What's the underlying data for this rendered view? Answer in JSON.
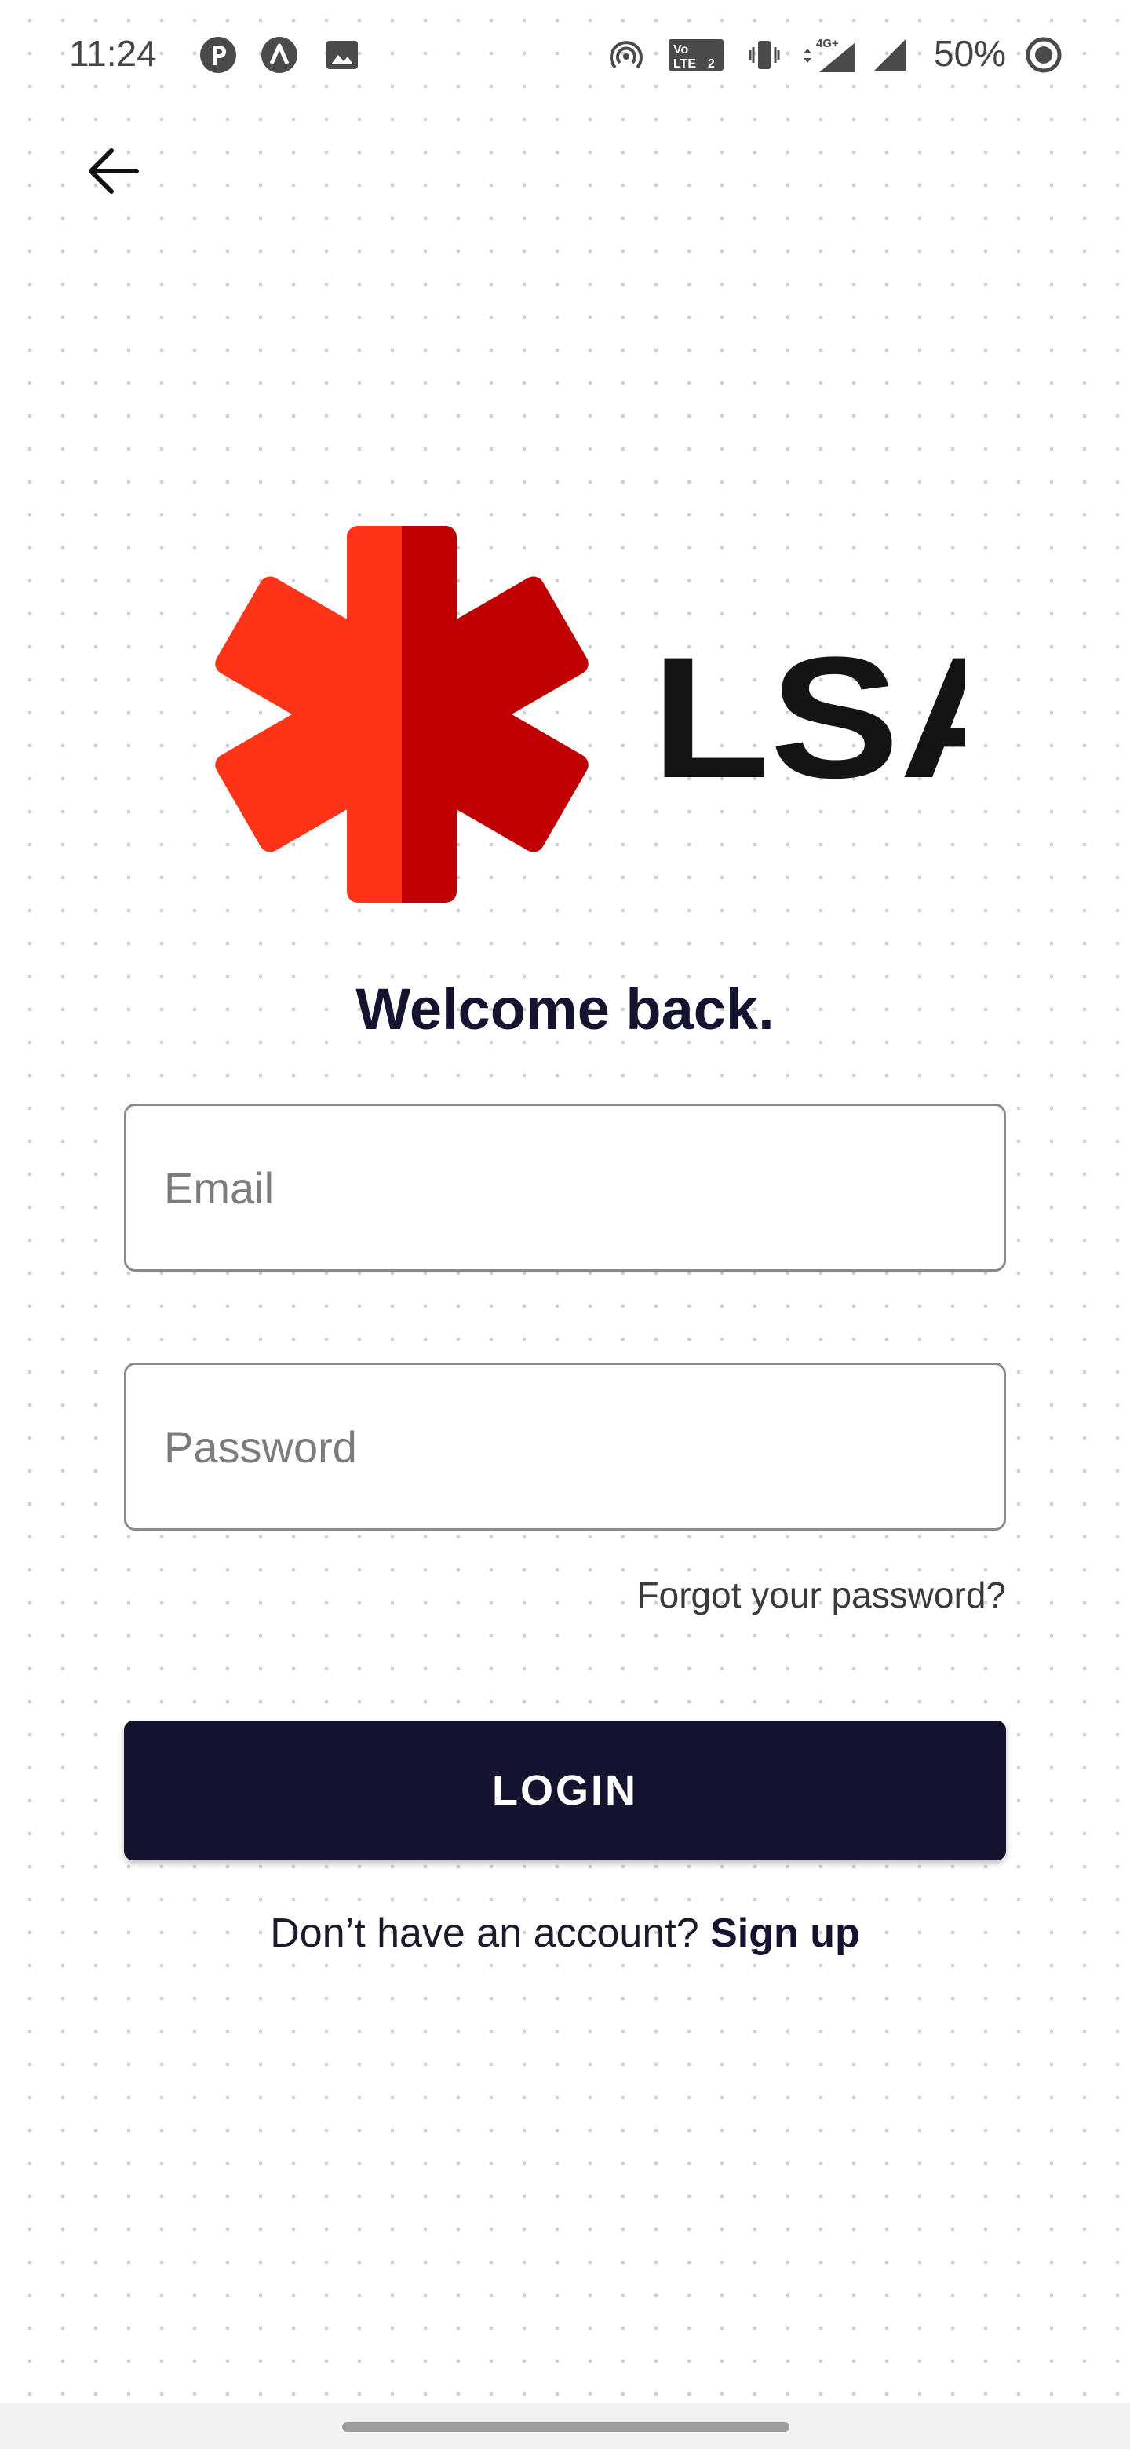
{
  "status_bar": {
    "time": "11:24",
    "battery_percent_text": "50%",
    "network_label": "4G+",
    "volte_label": "VoLTE",
    "sim_label": "2",
    "icons": [
      "p-app-icon",
      "a-app-icon",
      "image-icon",
      "hotspot-icon",
      "volte-icon",
      "vibrate-icon",
      "signal-4g-icon",
      "signal-icon",
      "battery-saver-icon"
    ]
  },
  "header": {
    "back_icon": "arrow-left-icon"
  },
  "logo": {
    "text": "LSAS",
    "colors": {
      "star_left": "#fd3418",
      "star_right": "#c00000",
      "text": "#141414"
    }
  },
  "form": {
    "title": "Welcome back.",
    "email_placeholder": "Email",
    "email_value": "",
    "password_placeholder": "Password",
    "password_value": "",
    "forgot_password_label": "Forgot your password?",
    "login_label": "LOGIN",
    "signup_prompt": "Don’t have an account?",
    "signup_label": "Sign up"
  },
  "colors": {
    "primary": "#141431",
    "background": "#ffffff",
    "dot_pattern": "#cfcfcf"
  }
}
